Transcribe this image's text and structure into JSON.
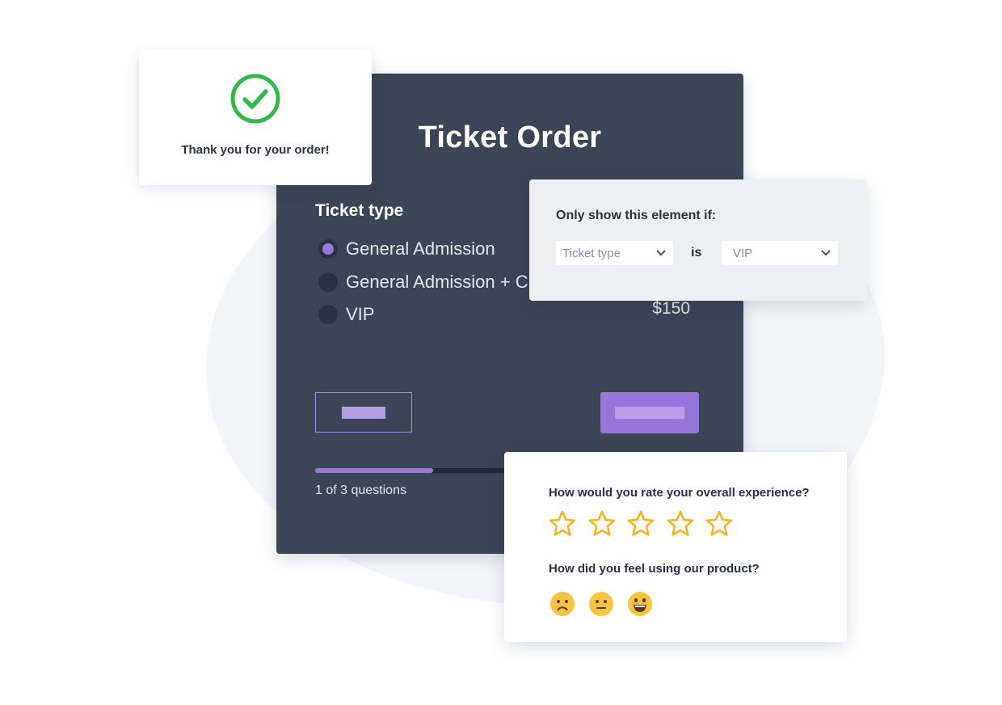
{
  "ticket_form": {
    "title": "Ticket Order",
    "field_label": "Ticket type",
    "options": [
      {
        "label": "General Admission",
        "selected": true
      },
      {
        "label": "General Admission + C",
        "selected": false
      },
      {
        "label": "VIP",
        "selected": false
      }
    ],
    "price": "$150",
    "progress": {
      "text": "1 of 3 questions",
      "fraction": 0.34
    }
  },
  "thank_you": {
    "message": "Thank you for your order!"
  },
  "logic": {
    "title": "Only show this element if:",
    "field": "Ticket type",
    "operator": "is",
    "value": "VIP"
  },
  "feedback": {
    "question_rating": "How would you rate your overall experience?",
    "star_count": 5,
    "question_feeling": "How did you feel using our product?",
    "faces": [
      "sad-face-icon",
      "neutral-face-icon",
      "happy-face-icon"
    ]
  },
  "colors": {
    "panel": "#3b4556",
    "accent": "#9b79d6",
    "success": "#34b84a",
    "star": "#f0b429"
  }
}
